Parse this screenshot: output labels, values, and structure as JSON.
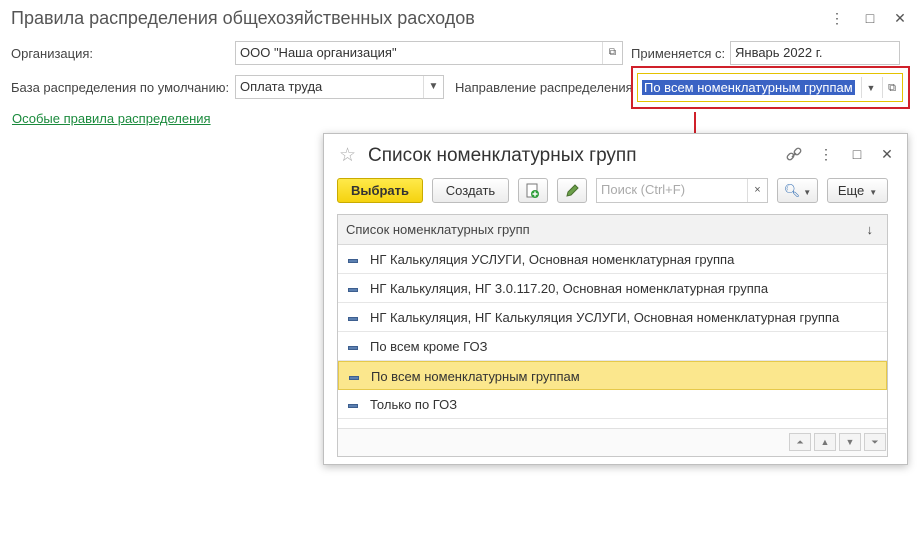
{
  "window": {
    "title": "Правила распределения общехозяйственных расходов",
    "controls": {
      "menu": "⋮",
      "maximize": "□",
      "close": "✕"
    }
  },
  "form": {
    "org_label": "Организация:",
    "org_value": "ООО \"Наша организация\"",
    "applies_label": "Применяется с:",
    "applies_value": "Январь 2022 г.",
    "base_label": "База распределения по умолчанию:",
    "base_value": "Оплата труда",
    "direction_label": "Направление распределения",
    "direction_value": "По всем номенклатурным группам",
    "special_rules_link": "Особые правила распределения"
  },
  "dialog": {
    "title": "Список номенклатурных групп",
    "toolbar": {
      "select_label": "Выбрать",
      "create_label": "Создать",
      "search_placeholder": "Поиск (Ctrl+F)",
      "more_label": "Еще"
    },
    "table": {
      "header": "Список номенклатурных групп",
      "sort_indicator": "↓",
      "rows": [
        "НГ Калькуляция УСЛУГИ, Основная номенклатурная группа",
        "НГ Калькуляция, НГ 3.0.117.20, Основная номенклатурная группа",
        "НГ Калькуляция, НГ Калькуляция УСЛУГИ, Основная номенклатурная группа",
        "По всем кроме ГОЗ",
        "По всем номенклатурным группам",
        "Только по ГОЗ"
      ],
      "selected_index": 4
    }
  },
  "colors": {
    "highlight_frame": "#d0202a",
    "link": "#1a8a3c",
    "primary_button": "#f5d30f",
    "selected_row": "#fbe78d",
    "arrow": "#d0202a"
  }
}
